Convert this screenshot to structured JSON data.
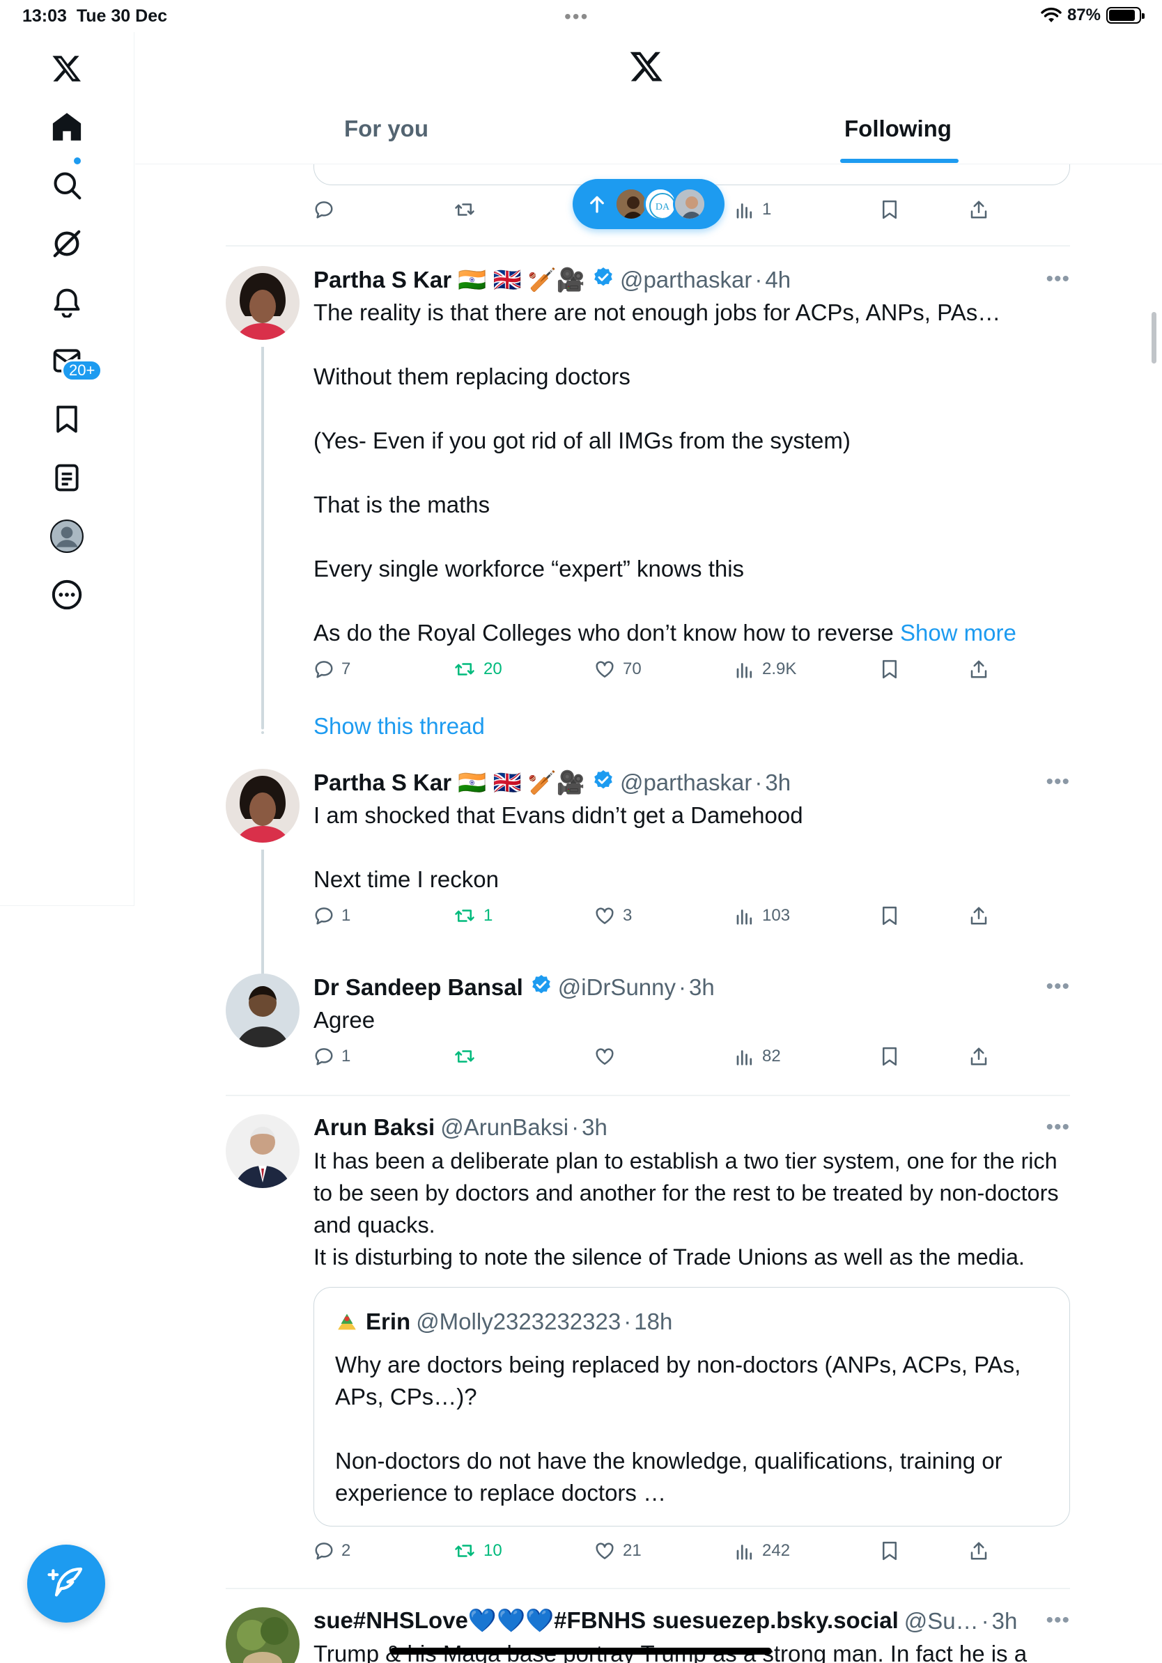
{
  "status_bar": {
    "time": "13:03",
    "date": "Tue 30 Dec",
    "battery": "87%",
    "battery_level": 0.87
  },
  "sidebar": {
    "items": [
      {
        "name": "x-logo",
        "icon": "x-logo-icon"
      },
      {
        "name": "home",
        "icon": "home-icon"
      },
      {
        "name": "explore",
        "icon": "search-icon"
      },
      {
        "name": "grok",
        "icon": "grok-icon"
      },
      {
        "name": "notifications",
        "icon": "bell-icon",
        "badge": "20+"
      },
      {
        "name": "messages",
        "icon": "envelope-icon"
      },
      {
        "name": "bookmarks",
        "icon": "bookmark-icon"
      },
      {
        "name": "lists",
        "icon": "list-icon"
      },
      {
        "name": "profile",
        "icon": "profile-icon"
      },
      {
        "name": "more",
        "icon": "more-circle-icon"
      }
    ],
    "notifications_badge": "20+"
  },
  "header": {
    "tabs": [
      {
        "label": "For you",
        "active": false
      },
      {
        "label": "Following",
        "active": true
      }
    ]
  },
  "colors": {
    "accent": "#1d9bf0",
    "retweet": "#00ba7c",
    "secondary_text": "#536471"
  },
  "top_actions": {
    "views": "1"
  },
  "posts": [
    {
      "name": "Partha S Kar 🇮🇳 🇬🇧 🏏🎥",
      "handle": "@parthaskar",
      "time": "4h",
      "verified": true,
      "text": "The reality is that there are not enough jobs for ACPs, ANPs, PAs…\n\nWithout them replacing doctors\n\n(Yes- Even if you got rid of all IMGs from the system)\n\nThat is the maths\n\nEvery single workforce “expert” knows this\n\nAs do the Royal Colleges who don’t know how to reverse ",
      "show_more": "Show more",
      "replies": "7",
      "reposts": "20",
      "likes": "70",
      "views": "2.9K",
      "show_thread": "Show this thread"
    },
    {
      "name": "Partha S Kar 🇮🇳 🇬🇧 🏏🎥",
      "handle": "@parthaskar",
      "time": "3h",
      "verified": true,
      "text": "I am shocked that Evans didn’t get a Damehood\n\nNext time I reckon",
      "replies": "1",
      "reposts": "1",
      "likes": "3",
      "views": "103"
    },
    {
      "name": "Dr Sandeep Bansal",
      "handle": "@iDrSunny",
      "time": "3h",
      "verified": true,
      "text": "Agree",
      "replies": "1",
      "reposts": "",
      "likes": "",
      "views": "82"
    },
    {
      "name": "Arun Baksi",
      "handle": "@ArunBaksi",
      "time": "3h",
      "verified": false,
      "text": "It has been a deliberate plan to establish a two tier system, one for the rich to be seen by doctors and another for the rest to be treated by non-doctors and quacks.\nIt is disturbing to note the silence of Trade Unions as well as the media.",
      "quote": {
        "name": "Erin",
        "handle": "@Molly2323232323",
        "time": "18h",
        "text": "Why are doctors being replaced by non-doctors (ANPs, ACPs, PAs, APs, CPs…)?\n\nNon-doctors do not have the knowledge, qualifications, training or experience to replace doctors …"
      },
      "replies": "2",
      "reposts": "10",
      "likes": "21",
      "views": "242"
    },
    {
      "name": "sue#NHSLove💙💙💙#FBNHS suesuezep.bsky.social",
      "handle": "@Su…",
      "time": "3h",
      "text": "Trump & his Maga base portray Trump as a strong man.  In fact he is a"
    }
  ]
}
